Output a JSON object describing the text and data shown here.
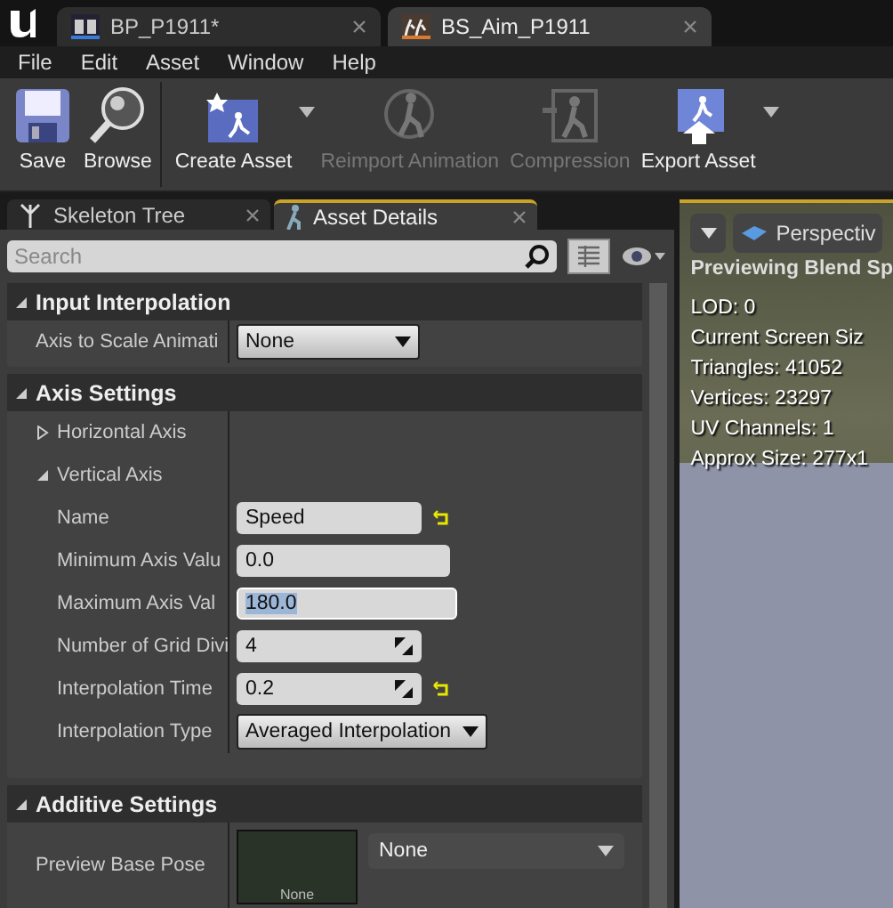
{
  "document_tabs": [
    {
      "label": "BP_P1911*",
      "kind": "blueprint",
      "selected": false
    },
    {
      "label": "BS_Aim_P1911",
      "kind": "blendspace",
      "selected": true
    }
  ],
  "menu": [
    "File",
    "Edit",
    "Asset",
    "Window",
    "Help"
  ],
  "toolbar": [
    {
      "label": "Save",
      "kind": "save",
      "disabled": false,
      "has_menu": false
    },
    {
      "label": "Browse",
      "kind": "browse",
      "disabled": false,
      "has_menu": false
    },
    {
      "label": "Create Asset",
      "kind": "create",
      "disabled": false,
      "has_menu": true
    },
    {
      "label": "Reimport Animation",
      "kind": "reimport",
      "disabled": true,
      "has_menu": false
    },
    {
      "label": "Compression",
      "kind": "compression",
      "disabled": true,
      "has_menu": false
    },
    {
      "label": "Export Asset",
      "kind": "export",
      "disabled": false,
      "has_menu": true
    }
  ],
  "panel_tabs": [
    {
      "label": "Skeleton Tree",
      "kind": "tree",
      "selected": false
    },
    {
      "label": "Asset Details",
      "kind": "details",
      "selected": true
    }
  ],
  "search": {
    "placeholder": "Search"
  },
  "sections": [
    {
      "title": "Input Interpolation",
      "expanded": true,
      "rows": [
        {
          "kind": "combo",
          "label": "Axis to Scale Animati",
          "value": "None"
        }
      ]
    },
    {
      "title": "Axis Settings",
      "expanded": true,
      "rows": [
        {
          "kind": "group",
          "label": "Horizontal Axis",
          "expanded": false
        },
        {
          "kind": "group",
          "label": "Vertical Axis",
          "expanded": true,
          "children": [
            {
              "kind": "text",
              "label": "Name",
              "value": "Speed",
              "reset": true,
              "focused": false
            },
            {
              "kind": "text",
              "label": "Minimum Axis Valu",
              "value": "0.0",
              "reset": false,
              "focused": false
            },
            {
              "kind": "text",
              "label": "Maximum Axis Val",
              "value": "180.0",
              "reset": false,
              "focused": true
            },
            {
              "kind": "spin",
              "label": "Number of Grid Divi",
              "value": "4",
              "reset": false
            },
            {
              "kind": "spin",
              "label": "Interpolation Time",
              "value": "0.2",
              "reset": true
            },
            {
              "kind": "combo",
              "label": "Interpolation Type",
              "value": "Averaged Interpolation"
            }
          ]
        }
      ]
    },
    {
      "title": "Additive Settings",
      "expanded": true,
      "rows": [
        {
          "kind": "asset",
          "label": "Preview Base Pose",
          "thumb": "None",
          "value": "None"
        }
      ]
    }
  ],
  "viewport": {
    "view_mode": "Perspectiv",
    "heading": "Previewing Blend Sp",
    "stats": [
      "LOD: 0",
      "Current Screen Siz",
      "Triangles: 41052",
      "Vertices: 23297",
      "UV Channels: 1",
      "Approx Size: 277x1"
    ]
  }
}
